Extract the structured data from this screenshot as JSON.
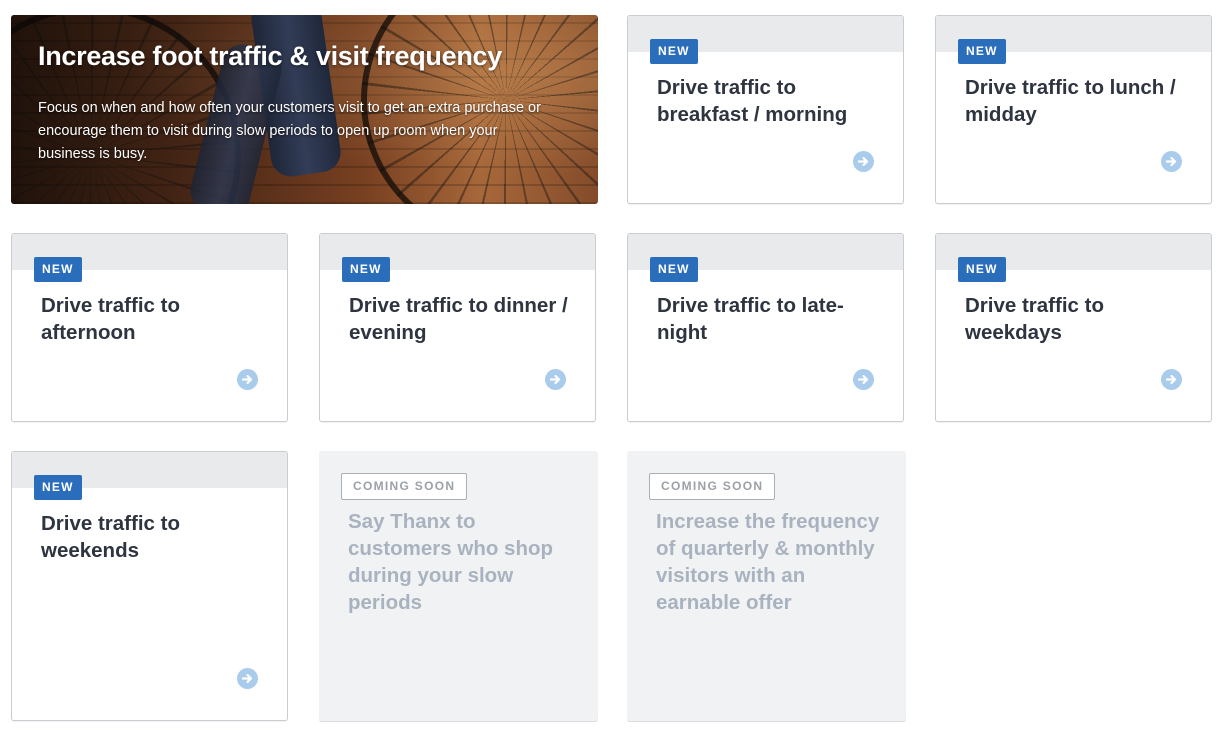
{
  "hero": {
    "title": "Increase foot traffic & visit frequency",
    "description": "Focus on when and how often your customers visit to get an extra purchase or encourage them to visit during slow periods to open up room when your business is busy."
  },
  "cards": [
    {
      "badge": "NEW",
      "title": "Drive traffic to breakfast / morning",
      "icon": "arrow-right-circle-icon"
    },
    {
      "badge": "NEW",
      "title": "Drive traffic to lunch / midday",
      "icon": "arrow-right-circle-icon"
    },
    {
      "badge": "NEW",
      "title": "Drive traffic to afternoon",
      "icon": "arrow-right-circle-icon"
    },
    {
      "badge": "NEW",
      "title": "Drive traffic to dinner / evening",
      "icon": "arrow-right-circle-icon"
    },
    {
      "badge": "NEW",
      "title": "Drive traffic to late-night",
      "icon": "arrow-right-circle-icon"
    },
    {
      "badge": "NEW",
      "title": "Drive traffic to weekdays",
      "icon": "arrow-right-circle-icon"
    },
    {
      "badge": "NEW",
      "title": "Drive traffic to weekends",
      "icon": "arrow-right-circle-icon"
    }
  ],
  "coming_soon": [
    {
      "badge": "COMING SOON",
      "title": "Say Thanx to customers who shop during your slow periods"
    },
    {
      "badge": "COMING SOON",
      "title": "Increase the frequency of quarterly & monthly visitors with an earnable offer"
    }
  ],
  "colors": {
    "badge_new": "#2a6ebb",
    "title_text": "#2e3440",
    "arrow_icon": "#a9cbec",
    "coming_soon_text": "#a9b3bf",
    "card_band": "#e9eaec"
  }
}
